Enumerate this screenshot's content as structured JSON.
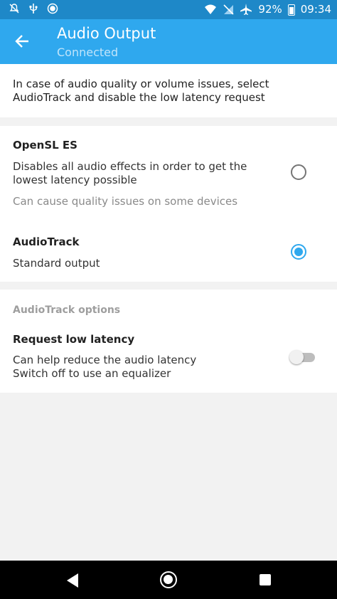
{
  "status_bar": {
    "battery_percent": "92%",
    "time": "09:34",
    "left_icons": [
      "notifications-off-icon",
      "usb-icon",
      "record-icon"
    ],
    "right_icons": [
      "wifi-icon",
      "no-sim-icon",
      "airplane-icon",
      "battery-charging-icon"
    ]
  },
  "app_bar": {
    "title": "Audio Output",
    "subtitle": "Connected",
    "color": "#2fa8ee"
  },
  "intro": {
    "text": "In case of audio quality or volume issues, select AudioTrack and disable the low latency request"
  },
  "options": [
    {
      "title": "OpenSL ES",
      "description": "Disables all audio effects in order to get the lowest latency possible",
      "note": "Can cause quality issues on some devices",
      "selected": false
    },
    {
      "title": "AudioTrack",
      "description": "Standard output",
      "selected": true
    }
  ],
  "audiotrack_options": {
    "header": "AudioTrack options",
    "low_latency": {
      "title": "Request low latency",
      "description_line1": "Can help reduce the audio latency",
      "description_line2": "Switch off to use an equalizer",
      "enabled": false
    }
  },
  "navigation": {
    "icons": [
      "nav-back-icon",
      "nav-home-icon",
      "nav-recents-icon"
    ]
  }
}
